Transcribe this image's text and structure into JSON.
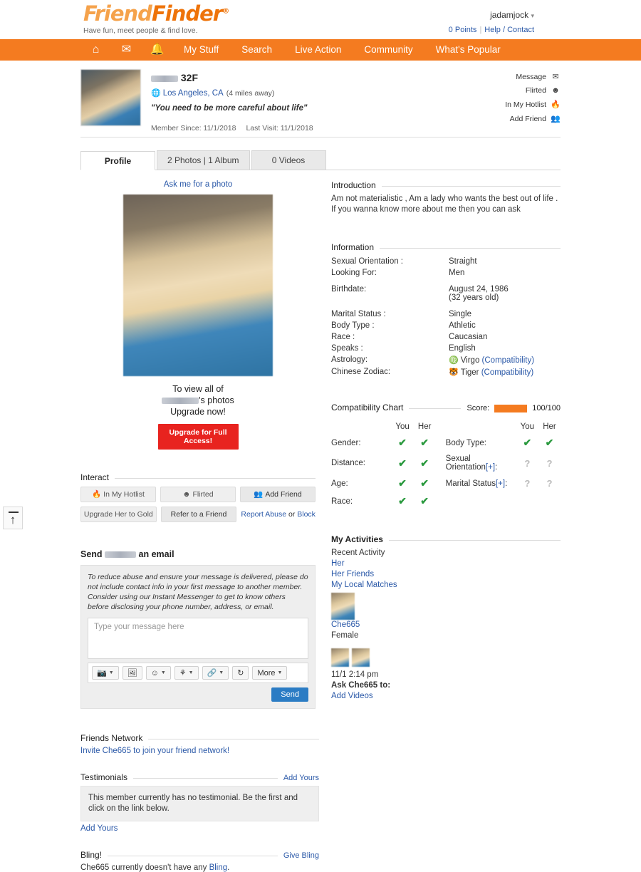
{
  "site": {
    "logo_part1": "Friend",
    "logo_part2": "Finder",
    "logo_reg": "®",
    "tagline": "Have fun, meet people & find love."
  },
  "account": {
    "username": "jadamjock",
    "caret": "▾",
    "points": "0",
    "points_label": "Points",
    "help_contact": "Help / Contact"
  },
  "nav": {
    "icons": [
      {
        "name": "home-icon",
        "glyph": "⌂"
      },
      {
        "name": "envelope-icon",
        "glyph": "✉"
      },
      {
        "name": "bell-icon",
        "glyph": "🔔"
      }
    ],
    "links": [
      "My Stuff",
      "Search",
      "Live Action",
      "Community",
      "What's Popular"
    ]
  },
  "profile": {
    "name_redacted": true,
    "age_gender": "32F",
    "location": "Los Angeles, CA",
    "distance": "(4 miles away)",
    "quote": "\"You need to be more careful about life\"",
    "member_since": "Member Since: 11/1/2018",
    "last_visit": "Last Visit: 11/1/2018",
    "actions": [
      {
        "label": "Message",
        "icon": "envelope-icon",
        "glyph": "✉"
      },
      {
        "label": "Flirted",
        "icon": "flirt-face-icon",
        "glyph": "☻"
      },
      {
        "label": "In My Hotlist",
        "icon": "flame-icon",
        "glyph": "🔥"
      },
      {
        "label": "Add Friend",
        "icon": "add-friend-icon",
        "glyph": "👥"
      }
    ]
  },
  "tabs": [
    {
      "label": "Profile",
      "active": true
    },
    {
      "label": "2 Photos | 1 Album",
      "active": false
    },
    {
      "label": "0 Videos",
      "active": false
    }
  ],
  "photo": {
    "ask_link": "Ask me for a photo",
    "upgrade_line1": "To view all of",
    "upgrade_line2_suffix": "'s photos",
    "upgrade_line3": "Upgrade now!",
    "upgrade_button": "Upgrade for Full Access!"
  },
  "interact": {
    "heading": "Interact",
    "buttons_row1": [
      {
        "label": "In My Hotlist",
        "glyph": "🔥"
      },
      {
        "label": "Flirted",
        "glyph": "☻"
      },
      {
        "label": "Add Friend",
        "glyph": "👥"
      }
    ],
    "buttons_row2": [
      {
        "label": "Upgrade Her to Gold"
      },
      {
        "label": "Refer to a Friend"
      }
    ],
    "report_abuse": "Report Abuse",
    "or": " or ",
    "block": "Block"
  },
  "email": {
    "title_prefix": "Send ",
    "title_suffix": " an email",
    "note": "To reduce abuse and ensure your message is delivered, please do not include contact info in your first message to another member. Consider using our Instant Messenger to get to know others before disclosing your phone number, address, or email.",
    "placeholder": "Type your message here",
    "toolbar": [
      {
        "name": "camera-icon",
        "glyph": "📷",
        "caret": "▾"
      },
      {
        "name": "send-card-icon",
        "glyph": "🖼",
        "caret": ""
      },
      {
        "name": "emoji-icon",
        "glyph": "☺",
        "caret": "▾"
      },
      {
        "name": "gift-icon",
        "glyph": "⚘",
        "caret": "▾"
      },
      {
        "name": "link-icon",
        "glyph": "🔗",
        "caret": "▾"
      },
      {
        "name": "refresh-icon",
        "glyph": "↻",
        "caret": ""
      },
      {
        "name": "more-menu",
        "glyph": "",
        "label": "More",
        "caret": "▾"
      }
    ],
    "send_label": "Send"
  },
  "introduction": {
    "heading": "Introduction",
    "text": "Am not materialistic , Am a lady who wants the best out of life . If you wanna know more about me then you can ask"
  },
  "information": {
    "heading": "Information",
    "rows": [
      {
        "key": "Sexual Orientation :",
        "value": "Straight"
      },
      {
        "key": "Looking For:",
        "value": "Men"
      },
      {
        "key": "Birthdate:",
        "value": "August 24, 1986",
        "value2": "(32 years old)",
        "gap": true
      },
      {
        "key": "Marital Status :",
        "value": "Single",
        "gap": true
      },
      {
        "key": "Body Type :",
        "value": "Athletic"
      },
      {
        "key": "Race :",
        "value": "Caucasian"
      },
      {
        "key": "Speaks :",
        "value": "English"
      },
      {
        "key": "Astrology:",
        "value": "Virgo",
        "link": "(Compatibility)",
        "zodiac": "♍"
      },
      {
        "key": "Chinese Zodiac:",
        "value": "Tiger",
        "link": "(Compatibility)",
        "zodiac": "🐯"
      }
    ]
  },
  "compatibility": {
    "heading": "Compatibility Chart",
    "score_label": "Score:",
    "score_text": "100/100",
    "score_percent": 100,
    "score_color": "#f47b20",
    "col_you": "You",
    "col_her": "Her",
    "left_rows": [
      {
        "label": "Gender:",
        "you": "check",
        "her": "check"
      },
      {
        "label": "Distance:",
        "you": "check",
        "her": "check"
      },
      {
        "label": "Age:",
        "you": "check",
        "her": "check"
      },
      {
        "label": "Race:",
        "you": "check",
        "her": "check"
      }
    ],
    "right_rows": [
      {
        "label": "Body Type:",
        "you": "check",
        "her": "check"
      },
      {
        "label": "Sexual Orientation",
        "bracket": "[+]",
        "suffix": ":",
        "you": "question",
        "her": "question"
      },
      {
        "label": "Marital Status",
        "bracket": "[+]",
        "suffix": ":",
        "you": "question",
        "her": "question"
      }
    ]
  },
  "activities": {
    "heading": "My Activities",
    "recent_label": "Recent Activity",
    "links": [
      "Her",
      "Her Friends",
      "My Local Matches"
    ],
    "member_name": "Che665",
    "member_gender": "Female",
    "timestamp": "11/1 2:14 pm",
    "ask_label": "Ask Che665 to:",
    "ask_link": "Add Videos"
  },
  "friends_network": {
    "heading": "Friends Network",
    "invite": "Invite Che665 to join your friend network!"
  },
  "testimonials": {
    "heading": "Testimonials",
    "add_yours": "Add Yours",
    "empty_text": "This member currently has no testimonial. Be the first and click on the link below.",
    "add_yours_link": "Add Yours"
  },
  "bling": {
    "heading": "Bling!",
    "give_link": "Give Bling",
    "text_prefix": "Che665 currently doesn't have any ",
    "text_link": "Bling",
    "text_suffix": "."
  },
  "scroll_top": {
    "name": "scroll-to-top-button",
    "glyph": "↑"
  }
}
